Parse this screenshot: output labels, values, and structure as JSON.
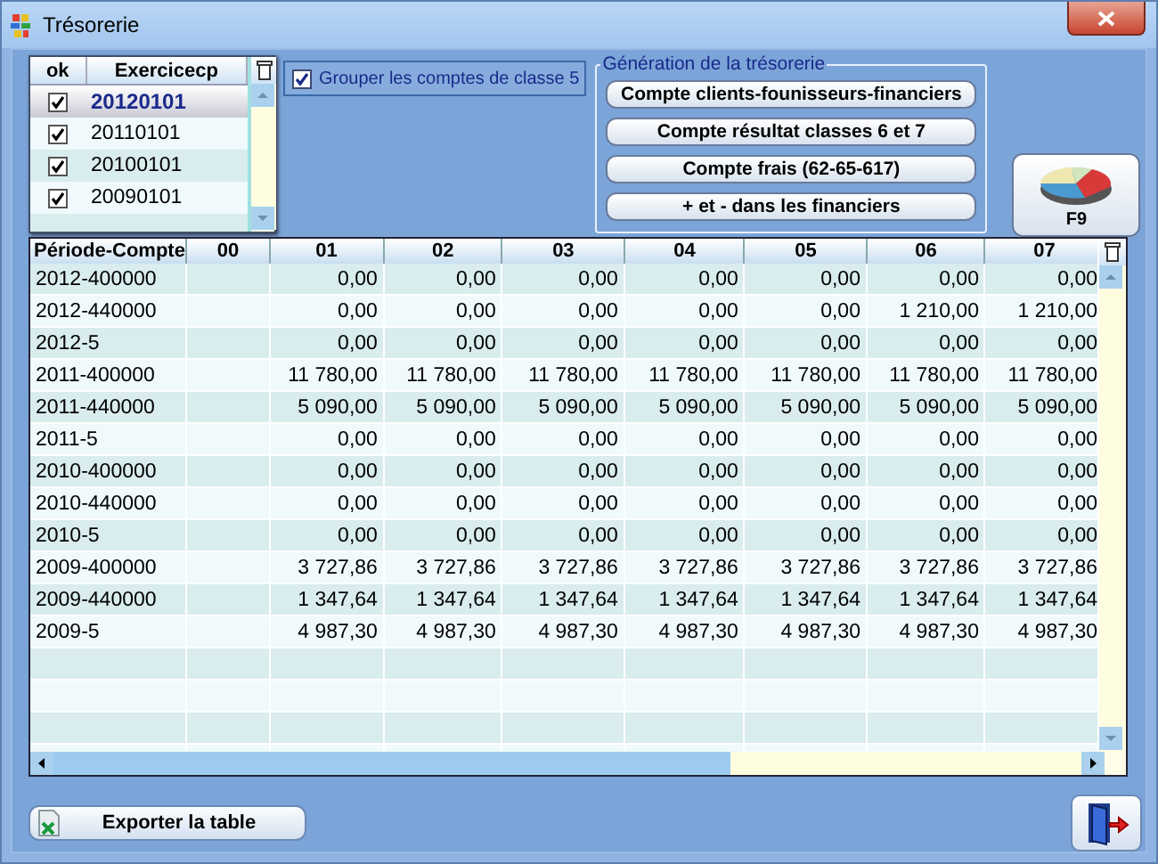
{
  "window": {
    "title": "Trésorerie"
  },
  "exercices": {
    "columns": [
      "ok",
      "Exercicecp"
    ],
    "rows": [
      {
        "value": "20120101",
        "checked": true,
        "selected": true
      },
      {
        "value": "20110101",
        "checked": true,
        "selected": false
      },
      {
        "value": "20100101",
        "checked": true,
        "selected": false
      },
      {
        "value": "20090101",
        "checked": true,
        "selected": false
      }
    ]
  },
  "group_option": {
    "label": "Grouper les comptes de classe 5",
    "checked": true
  },
  "generation": {
    "title": "Génération de la trésorerie",
    "buttons": [
      "Compte clients-founisseurs-financiers",
      "Compte résultat classes 6 et 7",
      "Compte frais (62-65-617)",
      "+ et - dans les financiers"
    ]
  },
  "chart_button": {
    "label": "F9"
  },
  "table": {
    "columns": [
      "Période-Compte",
      "00",
      "01",
      "02",
      "03",
      "04",
      "05",
      "06",
      "07"
    ],
    "rows": [
      {
        "label": "2012-400000",
        "values": [
          "0,00",
          "0,00",
          "0,00",
          "0,00",
          "0,00",
          "0,00",
          "0,00"
        ]
      },
      {
        "label": "2012-440000",
        "values": [
          "0,00",
          "0,00",
          "0,00",
          "0,00",
          "0,00",
          "1 210,00",
          "1 210,00"
        ]
      },
      {
        "label": "2012-5",
        "values": [
          "0,00",
          "0,00",
          "0,00",
          "0,00",
          "0,00",
          "0,00",
          "0,00"
        ]
      },
      {
        "label": "2011-400000",
        "values": [
          "11 780,00",
          "11 780,00",
          "11 780,00",
          "11 780,00",
          "11 780,00",
          "11 780,00",
          "11 780,00"
        ]
      },
      {
        "label": "2011-440000",
        "values": [
          "5 090,00",
          "5 090,00",
          "5 090,00",
          "5 090,00",
          "5 090,00",
          "5 090,00",
          "5 090,00"
        ]
      },
      {
        "label": "2011-5",
        "values": [
          "0,00",
          "0,00",
          "0,00",
          "0,00",
          "0,00",
          "0,00",
          "0,00"
        ]
      },
      {
        "label": "2010-400000",
        "values": [
          "0,00",
          "0,00",
          "0,00",
          "0,00",
          "0,00",
          "0,00",
          "0,00"
        ]
      },
      {
        "label": "2010-440000",
        "values": [
          "0,00",
          "0,00",
          "0,00",
          "0,00",
          "0,00",
          "0,00",
          "0,00"
        ]
      },
      {
        "label": "2010-5",
        "values": [
          "0,00",
          "0,00",
          "0,00",
          "0,00",
          "0,00",
          "0,00",
          "0,00"
        ]
      },
      {
        "label": "2009-400000",
        "values": [
          "3 727,86",
          "3 727,86",
          "3 727,86",
          "3 727,86",
          "3 727,86",
          "3 727,86",
          "3 727,86"
        ]
      },
      {
        "label": "2009-440000",
        "values": [
          "1 347,64",
          "1 347,64",
          "1 347,64",
          "1 347,64",
          "1 347,64",
          "1 347,64",
          "1 347,64"
        ]
      },
      {
        "label": "2009-5",
        "values": [
          "4 987,30",
          "4 987,30",
          "4 987,30",
          "4 987,30",
          "4 987,30",
          "4 987,30",
          "4 987,30"
        ]
      }
    ]
  },
  "export_button": {
    "label": "Exporter la table"
  }
}
